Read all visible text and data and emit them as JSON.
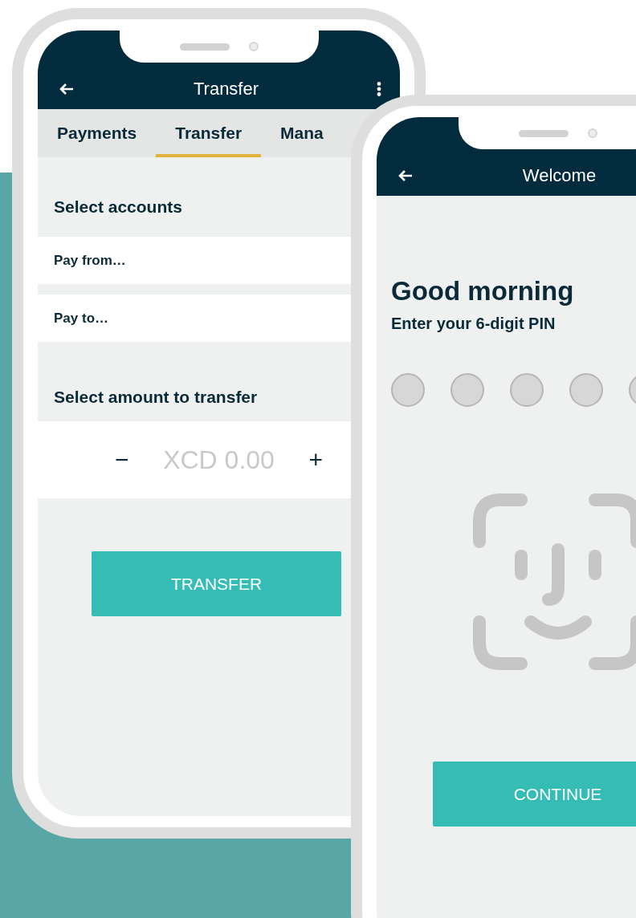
{
  "transfer_screen": {
    "title": "Transfer",
    "tabs": [
      {
        "label": "Payments",
        "selected": false
      },
      {
        "label": "Transfer",
        "selected": true
      },
      {
        "label": "Mana",
        "selected": false
      }
    ],
    "accounts_heading": "Select accounts",
    "account_fields": [
      {
        "placeholder": "Pay from…"
      },
      {
        "placeholder": "Pay to…"
      }
    ],
    "amount_heading": "Select amount to transfer",
    "amount": {
      "decrement": "−",
      "placeholder": "XCD 0.00",
      "increment": "+"
    },
    "button": "TRANSFER"
  },
  "welcome_screen": {
    "title": "Welcome",
    "greeting": "Good morning",
    "prompt": "Enter your 6-digit PIN",
    "pin_digits": [
      {
        "filled": false
      },
      {
        "filled": false
      },
      {
        "filled": false
      },
      {
        "filled": false
      },
      {
        "filled": false
      }
    ],
    "button": "CONTINUE"
  }
}
